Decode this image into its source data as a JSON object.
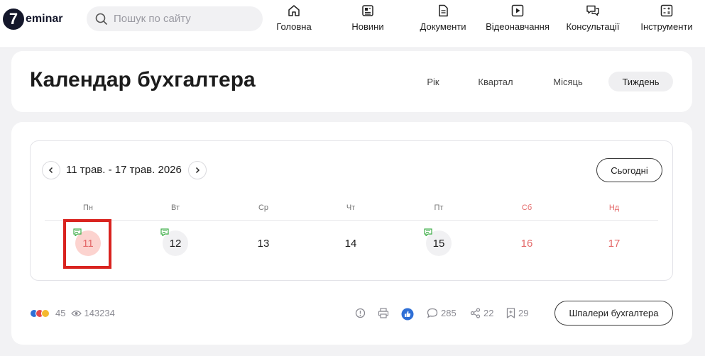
{
  "brand": {
    "logo_mark": "7",
    "logo_text": "eminar"
  },
  "search": {
    "placeholder": "Пошук по сайту",
    "value": ""
  },
  "nav": [
    {
      "label": "Головна",
      "icon": "home-icon"
    },
    {
      "label": "Новини",
      "icon": "newspaper-icon"
    },
    {
      "label": "Документи",
      "icon": "document-icon"
    },
    {
      "label": "Відеонавчання",
      "icon": "video-icon"
    },
    {
      "label": "Консультації",
      "icon": "chat-icon"
    },
    {
      "label": "Інструменти",
      "icon": "tools-icon"
    }
  ],
  "page": {
    "title": "Календар бухгалтера"
  },
  "view_tabs": [
    {
      "label": "Рік",
      "active": false
    },
    {
      "label": "Квартал",
      "active": false
    },
    {
      "label": "Місяць",
      "active": false
    },
    {
      "label": "Тиждень",
      "active": true
    }
  ],
  "calendar": {
    "range": "11 трав. - 17 трав. 2026",
    "today_label": "Сьогодні",
    "weekdays": [
      "Пн",
      "Вт",
      "Ср",
      "Чт",
      "Пт",
      "Сб",
      "Нд"
    ],
    "days": [
      {
        "num": "11",
        "event": true,
        "selected": true,
        "weekend": false
      },
      {
        "num": "12",
        "event": true,
        "selected": false,
        "weekend": false
      },
      {
        "num": "13",
        "event": false,
        "selected": false,
        "weekend": false
      },
      {
        "num": "14",
        "event": false,
        "selected": false,
        "weekend": false
      },
      {
        "num": "15",
        "event": true,
        "selected": false,
        "weekend": false
      },
      {
        "num": "16",
        "event": false,
        "selected": false,
        "weekend": true
      },
      {
        "num": "17",
        "event": false,
        "selected": false,
        "weekend": true
      }
    ]
  },
  "footer": {
    "reactions": "45",
    "views": "143234",
    "comments": "285",
    "shares": "22",
    "bookmarks": "29",
    "wallpaper_label": "Шпалери бухгалтера"
  },
  "colors": {
    "accent_red": "#e46a6a",
    "selected_bg": "#fcd3cf",
    "event_green": "#3fae49",
    "like_blue": "#2f6fd6",
    "highlight_box": "#d9231f"
  }
}
